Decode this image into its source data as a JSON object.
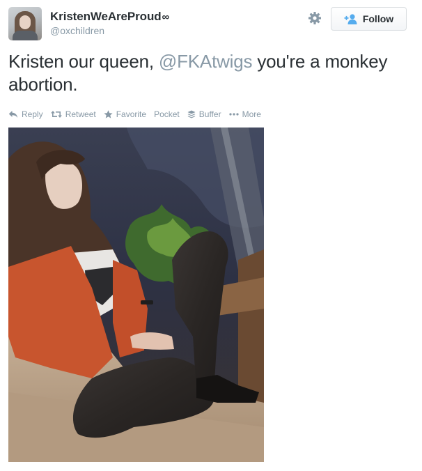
{
  "user": {
    "display_name": "KristenWeAreProud",
    "display_name_suffix": "∞",
    "screen_name": "@oxchildren"
  },
  "follow_button": {
    "label": "Follow"
  },
  "tweet": {
    "text_before": "Kristen our queen, ",
    "mention": "@FKAtwigs",
    "text_after": " you're a monkey abortion."
  },
  "actions": {
    "reply": "Reply",
    "retweet": "Retweet",
    "favorite": "Favorite",
    "pocket": "Pocket",
    "buffer": "Buffer",
    "more": "More"
  },
  "icons": {
    "gear": "gear-icon",
    "follow": "add-user-icon",
    "reply": "reply-arrow-icon",
    "retweet": "retweet-icon",
    "favorite": "star-icon",
    "buffer": "buffer-stack-icon",
    "more": "ellipsis-icon"
  },
  "colors": {
    "text": "#292f33",
    "muted": "#8899a6",
    "follow_icon": "#55acee"
  }
}
